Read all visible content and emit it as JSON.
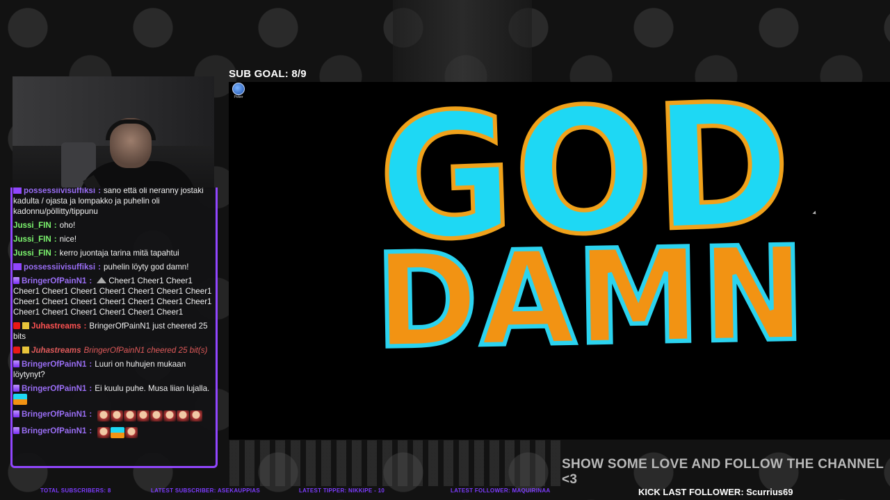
{
  "overlay": {
    "sub_goal": "SUB GOAL: 8/9",
    "poker_label": "Poker",
    "follow_banner": "SHOW SOME LOVE AND FOLLOW THE CHANNEL <3",
    "kick_follower": "KICK LAST FOLLOWER: Scurrius69",
    "tickers": [
      "TOTAL SUBSCRIBERS: 8",
      "LATEST SUBSCRIBER: ASEKAUPPIAS",
      "LATEST TIPPER: NIKKIPE - 10",
      "LATEST FOLLOWER: MAQUIRINAA"
    ]
  },
  "alert": {
    "line1": "GOD",
    "line2": "DAMN"
  },
  "chat": [
    {
      "user": "possessiivisuffiksi",
      "color": "purple",
      "text": "sano että oli neranny jostaki kadulta / ojasta ja lompakko ja puhelin oli kadonnu/pöllitty/tippunu"
    },
    {
      "user": "Jussi_FIN",
      "color": "green",
      "text": "oho!"
    },
    {
      "user": "Jussi_FIN",
      "color": "green",
      "text": "nice!"
    },
    {
      "user": "Jussi_FIN",
      "color": "green",
      "text": "kerro juontaja tarina mitä tapahtui"
    },
    {
      "user": "possessiivisuffiksi",
      "color": "purple",
      "text": "puhelin löyty god damn!"
    },
    {
      "user": "BringerOfPainN1",
      "color": "purple",
      "text": "Cheer1 Cheer1 Cheer1 Cheer1 Cheer1 Cheer1 Cheer1 Cheer1 Cheer1 Cheer1 Cheer1 Cheer1 Cheer1 Cheer1 Cheer1 Cheer1 Cheer1 Cheer1 Cheer1 Cheer1 Cheer1 Cheer1 Cheer1"
    },
    {
      "user": "Juhastreams",
      "color": "red",
      "text": "BringerOfPainN1 just cheered 25 bits"
    },
    {
      "user": "Juhastreams",
      "color": "red",
      "text": "BringerOfPainN1 cheered 25 bit(s)"
    },
    {
      "user": "BringerOfPainN1",
      "color": "purple",
      "text": "Luuri on huhujen mukaan löytynyt?"
    },
    {
      "user": "BringerOfPainN1",
      "color": "purple",
      "text": "Ei kuulu puhe. Musa liian lujalla."
    },
    {
      "user": "BringerOfPainN1",
      "color": "purple",
      "text": ""
    },
    {
      "user": "BringerOfPainN1",
      "color": "purple",
      "text": ""
    }
  ],
  "colors": {
    "accent": "#9146ff",
    "god_fill": "#1ed8f4",
    "damn_fill": "#f29313"
  },
  "icons": [
    "poker-app-icon",
    "sub-badge-icon",
    "cheer-icon",
    "god-damn-emote-icon",
    "kick-icon"
  ]
}
